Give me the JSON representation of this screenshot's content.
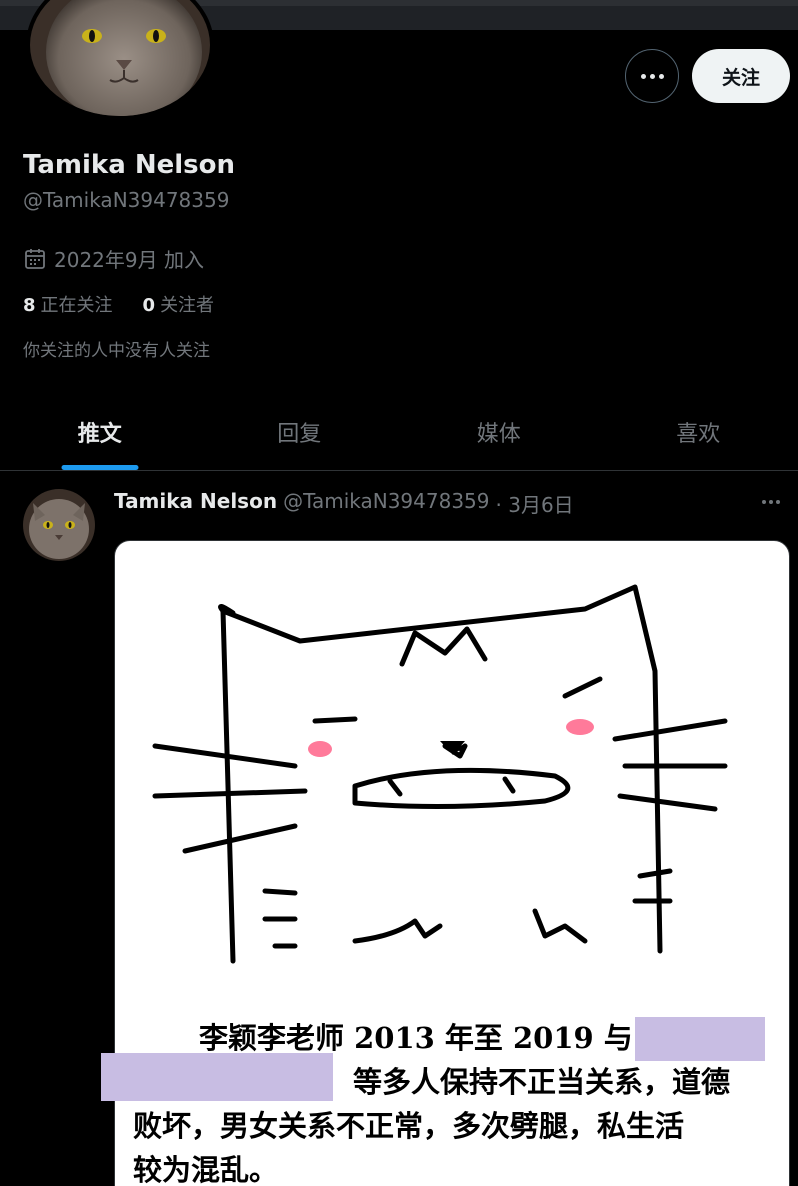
{
  "profile": {
    "display_name": "Tamika Nelson",
    "handle": "@TamikaN39478359",
    "joined": "2022年9月 加入",
    "following_count": "8",
    "following_label": "正在关注",
    "followers_count": "0",
    "followers_label": "关注者",
    "mutual_note": "你关注的人中没有人关注",
    "follow_button": "关注"
  },
  "tabs": [
    {
      "label": "推文"
    },
    {
      "label": "回复"
    },
    {
      "label": "媒体"
    },
    {
      "label": "喜欢"
    }
  ],
  "tweet": {
    "author_name": "Tamika Nelson",
    "author_handle": "@TamikaN39478359",
    "date": "· 3月6日",
    "image_text_line1": "李颖李老师 2013 年至 2019 与",
    "image_text_line2": "等多人保持不正当关系，道德",
    "image_text_line3": "败坏，男女关系不正常，多次劈腿，私生活",
    "image_text_line4": "较为混乱。"
  },
  "colors": {
    "accent": "#1d9bf0",
    "redaction": "#c8bde3"
  }
}
